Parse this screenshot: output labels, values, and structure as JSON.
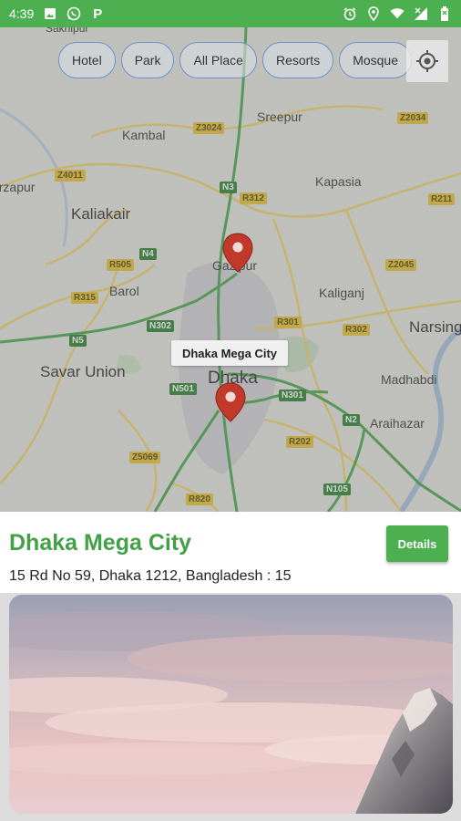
{
  "status_bar": {
    "time": "4:39",
    "left_icons": [
      "image-icon",
      "whatsapp-icon",
      "p-app-icon"
    ],
    "right_icons": [
      "alarm-icon",
      "location-icon",
      "wifi-icon",
      "signal-icon",
      "battery-icon"
    ],
    "p_glyph": "P"
  },
  "filters": {
    "chips": [
      "Hotel",
      "Park",
      "All Place",
      "Resorts",
      "Mosque"
    ]
  },
  "map": {
    "labels": {
      "savar_top": "Sakhipur",
      "kambal": "Kambal",
      "sreepur": "Sreepur",
      "mirzapur": "Mirzapur",
      "kapasia": "Kapasia",
      "kaliakair": "Kaliakair",
      "gazipur": "Gazipur",
      "barol": "Barol",
      "kaliganj": "Kaliganj",
      "narsingdi": "Narsing",
      "savar": "Savar Union",
      "dhaka": "Dhaka",
      "madhabdi": "Madhabdi",
      "araihazar": "Araihazar"
    },
    "roads": {
      "z3024": "Z3024",
      "z2034": "Z2034",
      "z4011": "Z4011",
      "n3": "N3",
      "r312": "R312",
      "r211": "R211",
      "n4": "N4",
      "r505": "R505",
      "z2045": "Z2045",
      "r315": "R315",
      "n302": "N302",
      "r301": "R301",
      "r302": "R302",
      "n5": "N5",
      "n501": "N501",
      "n301": "N301",
      "n2": "N2",
      "r202": "R202",
      "z5069": "Z5069",
      "n105": "N105",
      "r820": "R820"
    },
    "marker_tooltip": "Dhaka Mega City"
  },
  "place": {
    "title": "Dhaka Mega City",
    "address": "15 Rd No 59, Dhaka 1212, Bangladesh : 15",
    "details_label": "Details"
  },
  "colors": {
    "accent": "#4CAF50",
    "title_green": "#43a047",
    "pin_red": "#c0392b"
  }
}
